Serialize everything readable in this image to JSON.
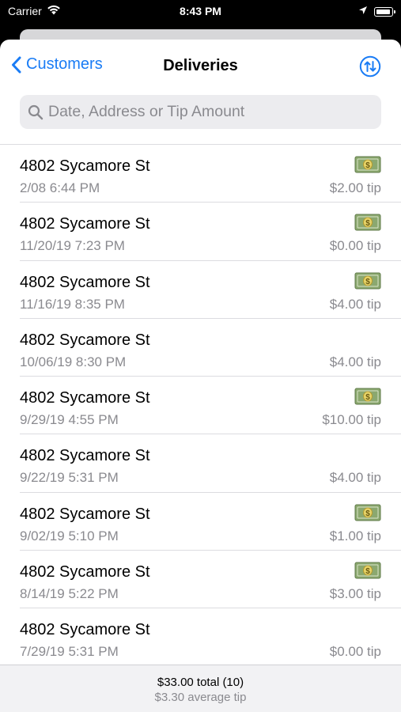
{
  "status": {
    "carrier": "Carrier",
    "time": "8:43 PM"
  },
  "nav": {
    "back_label": "Customers",
    "title": "Deliveries"
  },
  "search": {
    "placeholder": "Date, Address or Tip Amount",
    "value": ""
  },
  "deliveries": [
    {
      "address": "4802 Sycamore St",
      "date": "2/08 6:44 PM",
      "tip": "$2.00 tip",
      "cash_icon": true
    },
    {
      "address": "4802 Sycamore St",
      "date": "11/20/19 7:23 PM",
      "tip": "$0.00 tip",
      "cash_icon": true
    },
    {
      "address": "4802 Sycamore St",
      "date": "11/16/19 8:35 PM",
      "tip": "$4.00 tip",
      "cash_icon": true
    },
    {
      "address": "4802 Sycamore St",
      "date": "10/06/19 8:30 PM",
      "tip": "$4.00 tip",
      "cash_icon": false
    },
    {
      "address": "4802 Sycamore St",
      "date": "9/29/19 4:55 PM",
      "tip": "$10.00 tip",
      "cash_icon": true
    },
    {
      "address": "4802 Sycamore St",
      "date": "9/22/19 5:31 PM",
      "tip": "$4.00 tip",
      "cash_icon": false
    },
    {
      "address": "4802 Sycamore St",
      "date": "9/02/19 5:10 PM",
      "tip": "$1.00 tip",
      "cash_icon": true
    },
    {
      "address": "4802 Sycamore St",
      "date": "8/14/19 5:22 PM",
      "tip": "$3.00 tip",
      "cash_icon": true
    },
    {
      "address": "4802 Sycamore St",
      "date": "7/29/19 5:31 PM",
      "tip": "$0.00 tip",
      "cash_icon": false
    }
  ],
  "footer": {
    "total": "$33.00 total (10)",
    "average": "$3.30 average tip"
  },
  "colors": {
    "accent": "#1a7cf5",
    "secondary_text": "#8a8a8f",
    "search_bg": "#ececef"
  },
  "icons": {
    "back": "chevron-left-icon",
    "sort": "sort-arrows-icon",
    "search": "magnifying-glass-icon",
    "cash": "dollar-bill-icon"
  }
}
